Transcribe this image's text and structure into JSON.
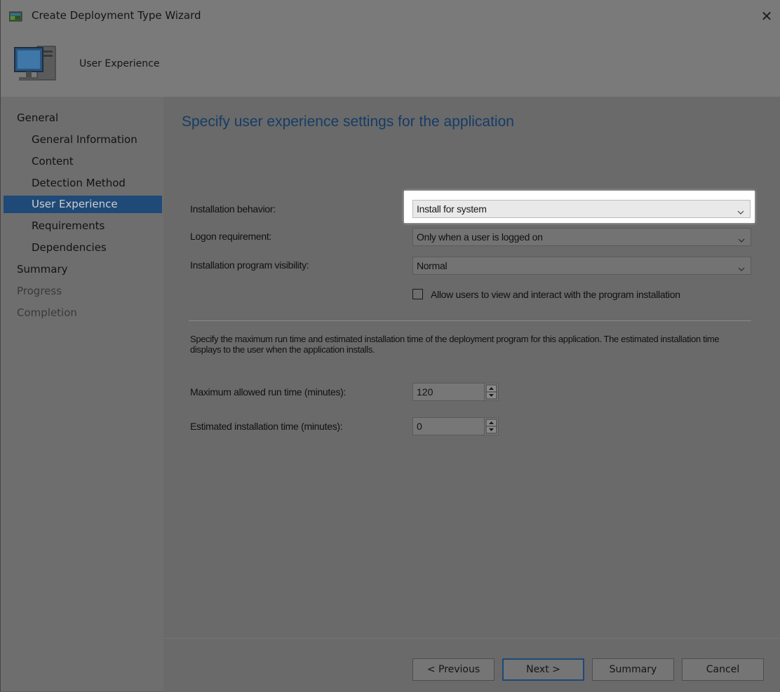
{
  "window": {
    "title": "Create Deployment Type Wizard",
    "close_glyph": "✕",
    "icon": "wizard-app-icon"
  },
  "header": {
    "title": "User Experience",
    "icon": "computer-monitor-icon"
  },
  "nav": {
    "items": [
      {
        "label": "General",
        "level": 0,
        "state": "normal"
      },
      {
        "label": "General Information",
        "level": 1,
        "state": "normal"
      },
      {
        "label": "Content",
        "level": 1,
        "state": "normal"
      },
      {
        "label": "Detection Method",
        "level": 1,
        "state": "normal"
      },
      {
        "label": "User Experience",
        "level": 1,
        "state": "selected"
      },
      {
        "label": "Requirements",
        "level": 1,
        "state": "normal"
      },
      {
        "label": "Dependencies",
        "level": 1,
        "state": "normal"
      },
      {
        "label": "Summary",
        "level": 0,
        "state": "normal"
      },
      {
        "label": "Progress",
        "level": 0,
        "state": "disabled"
      },
      {
        "label": "Completion",
        "level": 0,
        "state": "disabled"
      }
    ]
  },
  "main": {
    "heading": "Specify user experience settings for the application",
    "installation_behavior": {
      "label": "Installation behavior:",
      "value": "Install for system"
    },
    "logon_requirement": {
      "label": "Logon requirement:",
      "value": "Only when a user is logged on"
    },
    "program_visibility": {
      "label": "Installation program visibility:",
      "value": "Normal"
    },
    "allow_interact": {
      "label": "Allow users to view and interact with the program installation",
      "checked": false
    },
    "description": "Specify the maximum run time and estimated installation time of the deployment program for this application. The estimated installation time displays to the user when the application installs.",
    "max_run_time": {
      "label": "Maximum allowed run time (minutes):",
      "value": "120"
    },
    "est_install_time": {
      "label": "Estimated installation time (minutes):",
      "value": "0"
    }
  },
  "buttons": {
    "previous": "< Previous",
    "next": "Next >",
    "summary": "Summary",
    "cancel": "Cancel"
  },
  "colors": {
    "selection": "#1f4a78",
    "heading": "#163c66",
    "highlight": "#ffffff"
  }
}
